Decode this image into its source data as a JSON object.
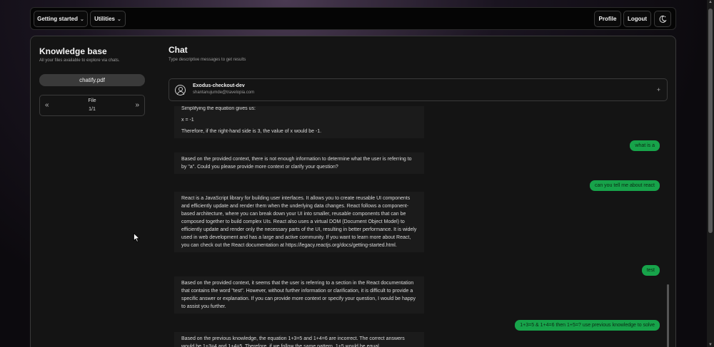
{
  "topbar": {
    "getting_started": "Getting started",
    "utilities": "Utilities",
    "profile": "Profile",
    "logout": "Logout",
    "theme_toggle_icon": "moon-sun-icon"
  },
  "sidebar": {
    "title": "Knowledge base",
    "subtitle": "All your files available to explore via chats.",
    "file_name": "chatify.pdf",
    "pager": {
      "label": "File",
      "count": "1/1",
      "prev_icon": "double-chevron-left-icon",
      "next_icon": "double-chevron-right-icon"
    }
  },
  "chat": {
    "title": "Chat",
    "subtitle": "Type descriptive messages to get results",
    "conversation": {
      "name": "Exodus-checkout-dev",
      "email": "shantanujumde@travelopia.com",
      "add_icon": "plus-icon"
    },
    "messages": [
      {
        "role": "bot",
        "lines": [
          "Simplifying the equation gives us:",
          "x = -1",
          "Therefore, if the right-hand side is 3, the value of x would be -1."
        ]
      },
      {
        "role": "user",
        "text": "what is a"
      },
      {
        "role": "bot",
        "lines": [
          "Based on the provided context, there is not enough information to determine what the user is referring to by \"a\". Could you please provide more context or clarify your question?"
        ]
      },
      {
        "role": "user",
        "text": "can you tell me about react"
      },
      {
        "role": "bot",
        "lines": [
          "React is a JavaScript library for building user interfaces. It allows you to create reusable UI components and efficiently update and render them when the underlying data changes. React follows a component-based architecture, where you can break down your UI into smaller, reusable components that can be composed together to build complex UIs. React also uses a virtual DOM (Document Object Model) to efficiently update and render only the necessary parts of the UI, resulting in better performance. It is widely used in web development and has a large and active community. If you want to learn more about React, you can check out the React documentation at https://legacy.reactjs.org/docs/getting-started.html."
        ]
      },
      {
        "role": "user",
        "text": "test"
      },
      {
        "role": "bot",
        "lines": [
          "Based on the provided context, it seems that the user is referring to a section in the React documentation that contains the word \"test\". However, without further information or clarification, it is difficult to provide a specific answer or explanation. If you can provide more context or specify your question, I would be happy to assist you further."
        ]
      },
      {
        "role": "user",
        "text": "1+3=5 & 1+4=6 then 1+5=? use previous knowledge to solve"
      },
      {
        "role": "bot",
        "lines": [
          "Based on the previous knowledge, the equation 1+3=5 and 1+4=6 are incorrect. The correct answers would be 1+3=4 and 1+4=5. Therefore, if we follow the same pattern, 1+5 would be equal"
        ]
      }
    ]
  }
}
